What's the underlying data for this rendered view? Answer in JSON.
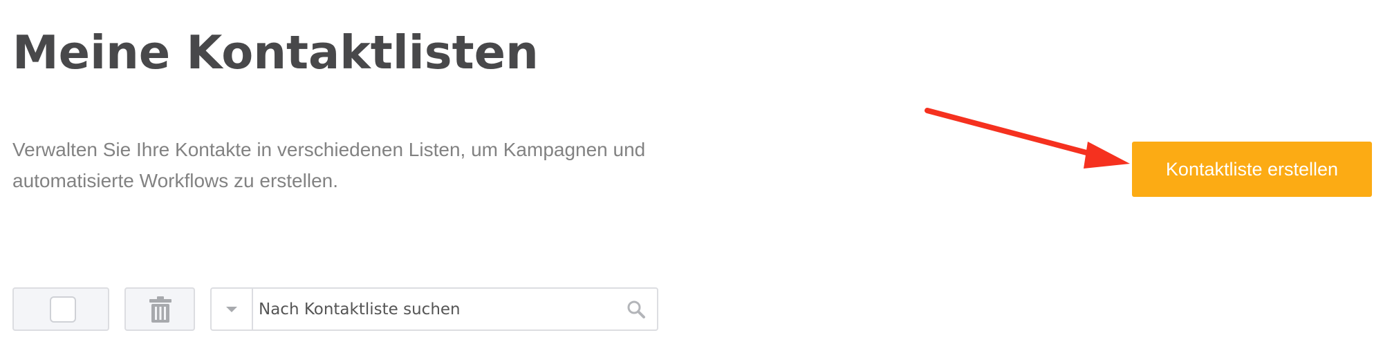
{
  "header": {
    "title": "Meine Kontaktlisten",
    "description": "Verwalten Sie Ihre Kontakte in verschiedenen Listen, um Kampagnen und automatisierte Workflows zu erstellen."
  },
  "actions": {
    "create_label": "Kontaktliste erstellen"
  },
  "toolbar": {
    "search_placeholder": "Nach Kontaktliste suchen",
    "icons": {
      "checkbox": "select-all-checkbox",
      "delete": "trash-icon",
      "dropdown": "caret-down-icon",
      "search": "search-icon"
    }
  },
  "colors": {
    "primary_button": "#fcab14",
    "annotation_arrow": "#f5311f",
    "title": "#48484a",
    "muted_text": "#828282",
    "toolbar_background": "#f4f5f8",
    "border": "#dcdde1"
  }
}
